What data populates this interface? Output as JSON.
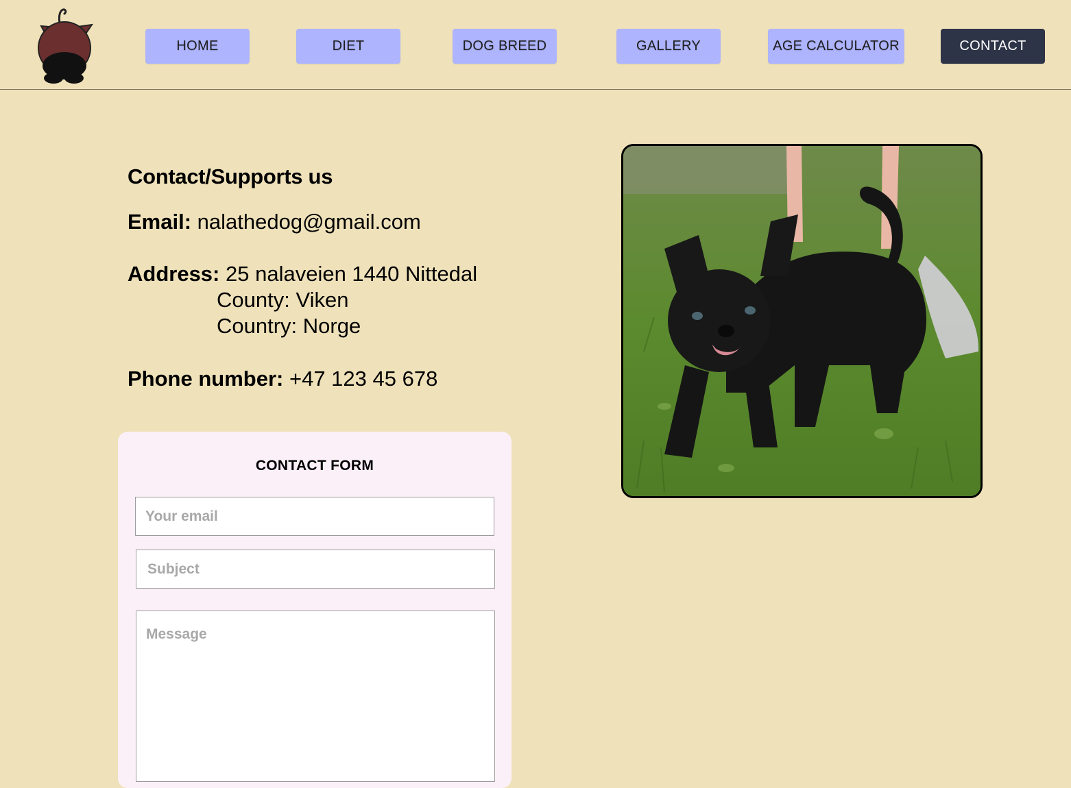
{
  "nav": {
    "items": [
      {
        "label": "HOME"
      },
      {
        "label": "DIET"
      },
      {
        "label": "DOG BREED"
      },
      {
        "label": "GALLERY"
      },
      {
        "label": "AGE CALCULATOR"
      },
      {
        "label": "CONTACT",
        "active": true
      }
    ]
  },
  "logo": {
    "icon": "dog-head-icon"
  },
  "contact": {
    "heading": "Contact/Supports us",
    "email_label": "Email:",
    "email_value": "nalathedog@gmail.com",
    "address_label": "Address:",
    "address_line1": "25 nalaveien 1440 Nittedal",
    "address_county": "County: Viken",
    "address_country": "Country: Norge",
    "phone_label": "Phone number:",
    "phone_value": "+47 123 45 678"
  },
  "form": {
    "title": "CONTACT FORM",
    "email_placeholder": "Your email",
    "subject_placeholder": "Subject",
    "message_placeholder": "Message"
  },
  "photo": {
    "subject": "black-dog-on-grass-photo"
  },
  "colors": {
    "background": "#efe1b9",
    "nav_button": "#aeb4fd",
    "nav_active": "#2e3447",
    "form_card": "#fcf0f8"
  }
}
